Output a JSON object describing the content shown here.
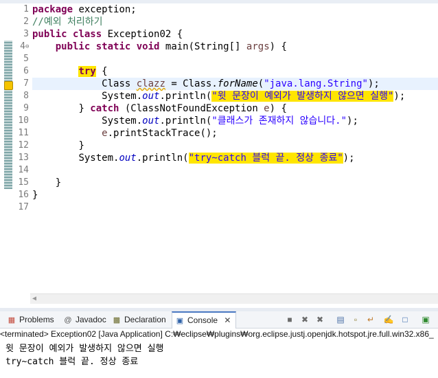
{
  "editor": {
    "line_numbers": [
      "1",
      "2",
      "3",
      "4",
      "5",
      "6",
      "7",
      "8",
      "9",
      "10",
      "11",
      "12",
      "13",
      "14",
      "15",
      "16",
      "17"
    ],
    "fold_marker": "⊖",
    "lines": {
      "l1_kw": "package",
      "l1_rest": " exception;",
      "l2_comment": "//예외 처리하기",
      "l3_kw1": "public",
      "l3_kw2": "class",
      "l3_rest": " Exception02 {",
      "l4_kw1": "public",
      "l4_kw2": "static",
      "l4_kw3": "void",
      "l4_rest": " main(String[] ",
      "l4_var": "args",
      "l4_end": ") {",
      "l6_try": "try",
      "l6_rest": " {",
      "l7_a": "Class ",
      "l7_var": "clazz",
      "l7_b": " = Class.",
      "l7_method": "forName",
      "l7_c": "(",
      "l7_str": "\"java.lang.String\"",
      "l7_d": ");",
      "l8_a": "System.",
      "l8_out": "out",
      "l8_b": ".println(",
      "l8_str": "\"윗 문장이 예외가 발생하지 않으면 실행\"",
      "l8_c": ");",
      "l9_a": "} ",
      "l9_catch": "catch",
      "l9_b": " (ClassNotFoundException ",
      "l9_var": "e",
      "l9_c": ") {",
      "l10_a": "System.",
      "l10_out": "out",
      "l10_b": ".println(",
      "l10_str": "\"클래스가 존재하지 않습니다.\"",
      "l10_c": ");",
      "l11_var": "e",
      "l11_rest": ".printStackTrace();",
      "l12": "}",
      "l13_a": "System.",
      "l13_out": "out",
      "l13_b": ".println(",
      "l13_str": "\"try~catch 블럭 끝. 정상 종료\"",
      "l13_c": ");",
      "l15": "}",
      "l16": "}"
    }
  },
  "tabs": [
    {
      "label": "Problems",
      "icon": "problems-icon"
    },
    {
      "label": "Javadoc",
      "icon": "javadoc-icon"
    },
    {
      "label": "Declaration",
      "icon": "declaration-icon"
    },
    {
      "label": "Console",
      "icon": "console-icon",
      "active": true
    }
  ],
  "console": {
    "header": "<terminated> Exception02 [Java Application] C:₩eclipse₩plugins₩org.eclipse.justj.openjdk.hotspot.jre.full.win32.x86_",
    "output": [
      "윗 문장이 예외가 발생하지 않으면 실행",
      "try~catch 블럭 끝. 정상 종료"
    ]
  },
  "colors": {
    "keyword": "#7f0055",
    "comment": "#3f7f5f",
    "string": "#2a00ff",
    "field": "#0000c0",
    "highlight": "#ffe500",
    "current_line": "#e8f2fe"
  }
}
